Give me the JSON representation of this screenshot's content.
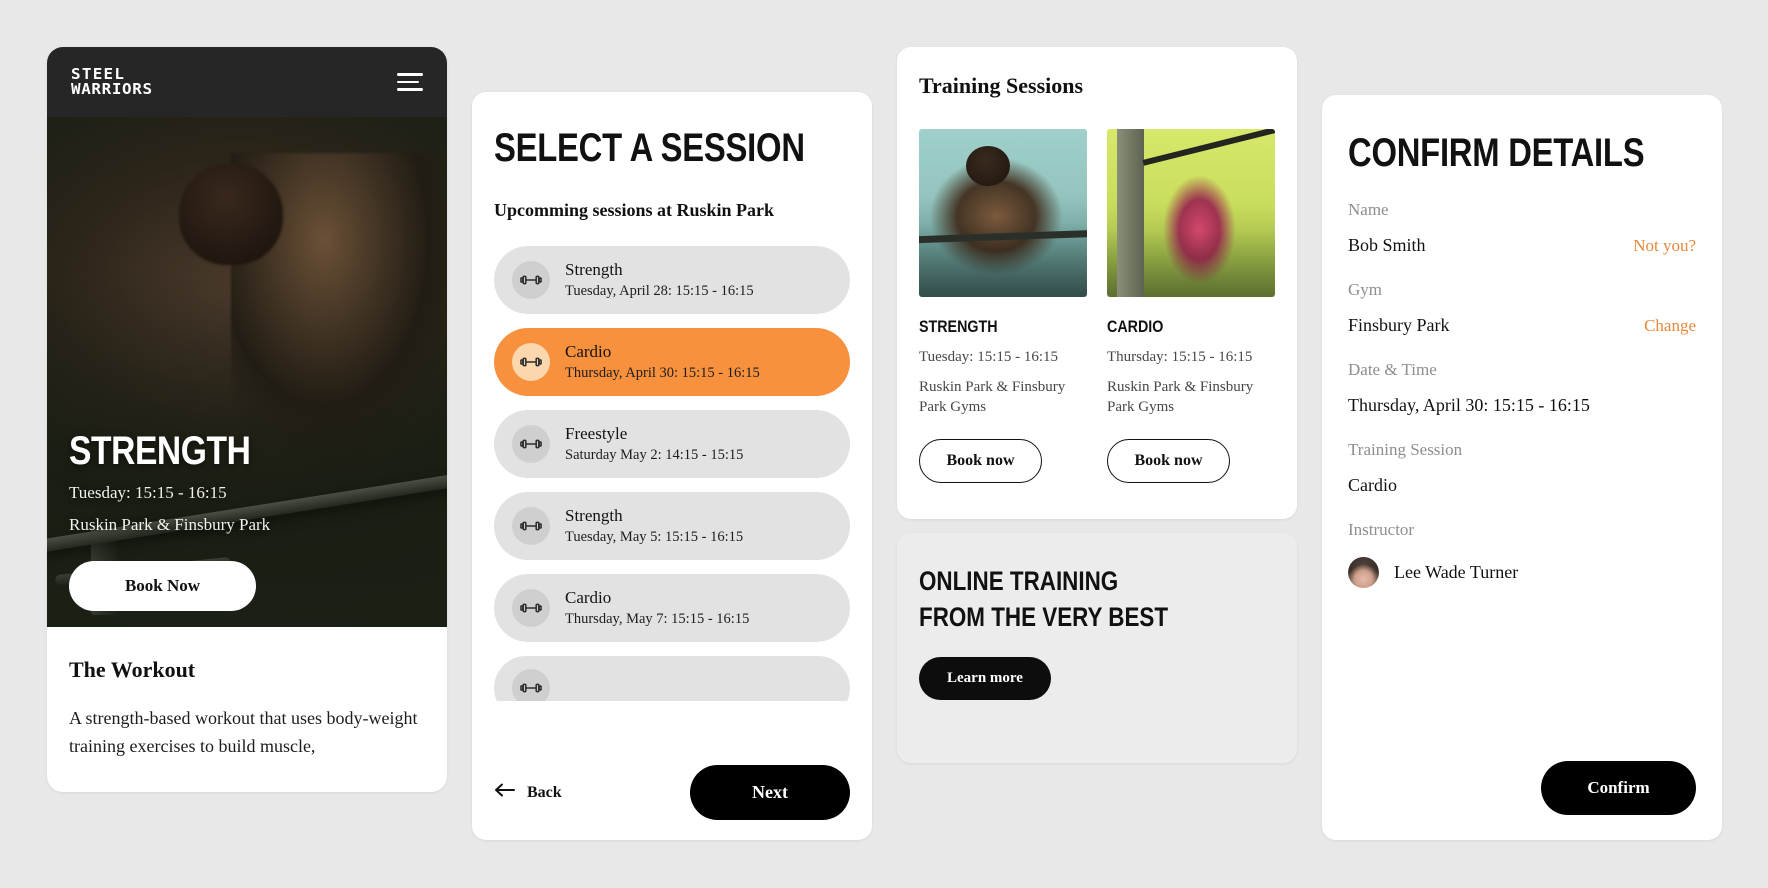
{
  "phone": {
    "logo_line1": "STEEL",
    "logo_line2": "WARRIORS",
    "menu_icon": "hamburger-icon",
    "hero": {
      "title": "STRENGTH",
      "time": "Tuesday: 15:15 - 16:15",
      "location": "Ruskin Park & Finsbury Park",
      "book_label": "Book Now"
    },
    "workout": {
      "heading": "The Workout",
      "body": "A strength-based workout that uses body-weight training exercises to build muscle,"
    }
  },
  "select": {
    "title": "SELECT A SESSION",
    "subtitle": "Upcomming sessions at Ruskin Park",
    "sessions": [
      {
        "name": "Strength",
        "when": "Tuesday, April 28: 15:15 - 16:15",
        "selected": false
      },
      {
        "name": "Cardio",
        "when": "Thursday, April 30: 15:15 - 16:15",
        "selected": true
      },
      {
        "name": "Freestyle",
        "when": "Saturday May 2: 14:15 - 15:15",
        "selected": false
      },
      {
        "name": "Strength",
        "when": "Tuesday, May 5: 15:15 - 16:15",
        "selected": false
      },
      {
        "name": "Cardio",
        "when": "Thursday, May 7: 15:15 - 16:15",
        "selected": false
      },
      {
        "name": "",
        "when": "",
        "selected": false
      }
    ],
    "back_label": "Back",
    "next_label": "Next",
    "accent_color": "#f7913d"
  },
  "training": {
    "title": "Training Sessions",
    "tiles": [
      {
        "name": "STRENGTH",
        "when": "Tuesday: 15:15 - 16:15",
        "location": "Ruskin Park & Finsbury Park Gyms",
        "book_label": "Book now"
      },
      {
        "name": "CARDIO",
        "when": "Thursday: 15:15 - 16:15",
        "location": "Ruskin Park & Finsbury Park Gyms",
        "book_label": "Book now"
      }
    ],
    "promo": {
      "line1": "ONLINE TRAINING",
      "line2": "FROM THE VERY BEST",
      "cta_label": "Learn more"
    }
  },
  "confirm": {
    "title": "CONFIRM DETAILS",
    "fields": [
      {
        "label": "Name",
        "value": "Bob Smith",
        "action": "Not you?"
      },
      {
        "label": "Gym",
        "value": "Finsbury Park",
        "action": "Change"
      },
      {
        "label": "Date & Time",
        "value": "Thursday, April 30: 15:15 - 16:15",
        "action": ""
      },
      {
        "label": "Training Session",
        "value": "Cardio",
        "action": ""
      }
    ],
    "instructor_label": "Instructor",
    "instructor_name": "Lee Wade Turner",
    "confirm_label": "Confirm",
    "link_color": "#e8883c"
  }
}
